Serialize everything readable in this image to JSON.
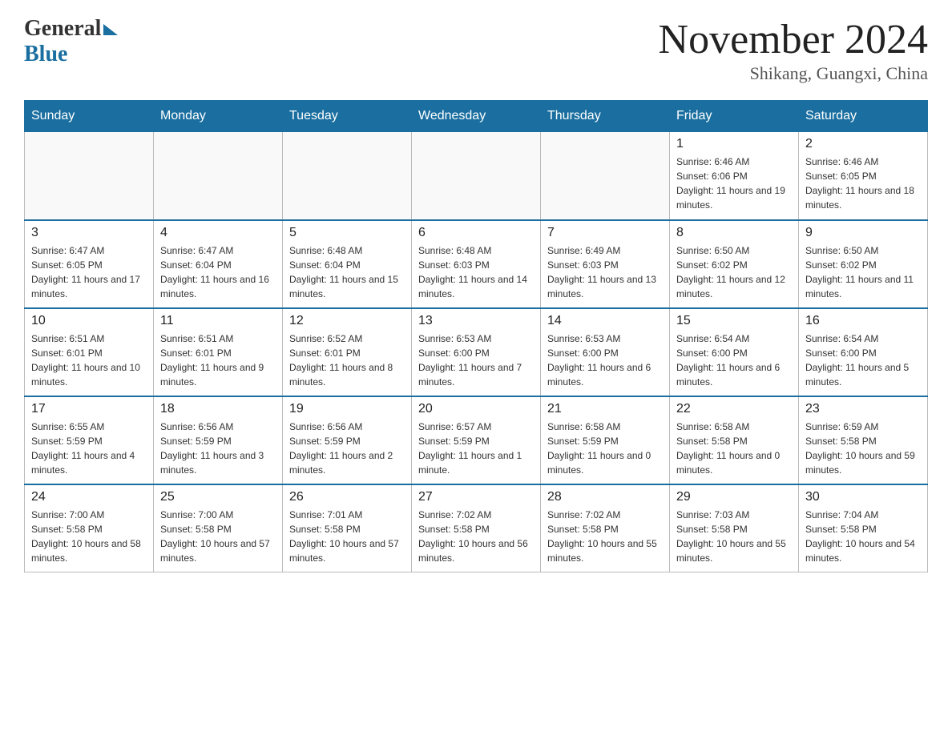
{
  "header": {
    "logo_general": "General",
    "logo_blue": "Blue",
    "month_title": "November 2024",
    "location": "Shikang, Guangxi, China"
  },
  "weekdays": [
    "Sunday",
    "Monday",
    "Tuesday",
    "Wednesday",
    "Thursday",
    "Friday",
    "Saturday"
  ],
  "weeks": [
    [
      {
        "day": "",
        "info": ""
      },
      {
        "day": "",
        "info": ""
      },
      {
        "day": "",
        "info": ""
      },
      {
        "day": "",
        "info": ""
      },
      {
        "day": "",
        "info": ""
      },
      {
        "day": "1",
        "info": "Sunrise: 6:46 AM\nSunset: 6:06 PM\nDaylight: 11 hours and 19 minutes."
      },
      {
        "day": "2",
        "info": "Sunrise: 6:46 AM\nSunset: 6:05 PM\nDaylight: 11 hours and 18 minutes."
      }
    ],
    [
      {
        "day": "3",
        "info": "Sunrise: 6:47 AM\nSunset: 6:05 PM\nDaylight: 11 hours and 17 minutes."
      },
      {
        "day": "4",
        "info": "Sunrise: 6:47 AM\nSunset: 6:04 PM\nDaylight: 11 hours and 16 minutes."
      },
      {
        "day": "5",
        "info": "Sunrise: 6:48 AM\nSunset: 6:04 PM\nDaylight: 11 hours and 15 minutes."
      },
      {
        "day": "6",
        "info": "Sunrise: 6:48 AM\nSunset: 6:03 PM\nDaylight: 11 hours and 14 minutes."
      },
      {
        "day": "7",
        "info": "Sunrise: 6:49 AM\nSunset: 6:03 PM\nDaylight: 11 hours and 13 minutes."
      },
      {
        "day": "8",
        "info": "Sunrise: 6:50 AM\nSunset: 6:02 PM\nDaylight: 11 hours and 12 minutes."
      },
      {
        "day": "9",
        "info": "Sunrise: 6:50 AM\nSunset: 6:02 PM\nDaylight: 11 hours and 11 minutes."
      }
    ],
    [
      {
        "day": "10",
        "info": "Sunrise: 6:51 AM\nSunset: 6:01 PM\nDaylight: 11 hours and 10 minutes."
      },
      {
        "day": "11",
        "info": "Sunrise: 6:51 AM\nSunset: 6:01 PM\nDaylight: 11 hours and 9 minutes."
      },
      {
        "day": "12",
        "info": "Sunrise: 6:52 AM\nSunset: 6:01 PM\nDaylight: 11 hours and 8 minutes."
      },
      {
        "day": "13",
        "info": "Sunrise: 6:53 AM\nSunset: 6:00 PM\nDaylight: 11 hours and 7 minutes."
      },
      {
        "day": "14",
        "info": "Sunrise: 6:53 AM\nSunset: 6:00 PM\nDaylight: 11 hours and 6 minutes."
      },
      {
        "day": "15",
        "info": "Sunrise: 6:54 AM\nSunset: 6:00 PM\nDaylight: 11 hours and 6 minutes."
      },
      {
        "day": "16",
        "info": "Sunrise: 6:54 AM\nSunset: 6:00 PM\nDaylight: 11 hours and 5 minutes."
      }
    ],
    [
      {
        "day": "17",
        "info": "Sunrise: 6:55 AM\nSunset: 5:59 PM\nDaylight: 11 hours and 4 minutes."
      },
      {
        "day": "18",
        "info": "Sunrise: 6:56 AM\nSunset: 5:59 PM\nDaylight: 11 hours and 3 minutes."
      },
      {
        "day": "19",
        "info": "Sunrise: 6:56 AM\nSunset: 5:59 PM\nDaylight: 11 hours and 2 minutes."
      },
      {
        "day": "20",
        "info": "Sunrise: 6:57 AM\nSunset: 5:59 PM\nDaylight: 11 hours and 1 minute."
      },
      {
        "day": "21",
        "info": "Sunrise: 6:58 AM\nSunset: 5:59 PM\nDaylight: 11 hours and 0 minutes."
      },
      {
        "day": "22",
        "info": "Sunrise: 6:58 AM\nSunset: 5:58 PM\nDaylight: 11 hours and 0 minutes."
      },
      {
        "day": "23",
        "info": "Sunrise: 6:59 AM\nSunset: 5:58 PM\nDaylight: 10 hours and 59 minutes."
      }
    ],
    [
      {
        "day": "24",
        "info": "Sunrise: 7:00 AM\nSunset: 5:58 PM\nDaylight: 10 hours and 58 minutes."
      },
      {
        "day": "25",
        "info": "Sunrise: 7:00 AM\nSunset: 5:58 PM\nDaylight: 10 hours and 57 minutes."
      },
      {
        "day": "26",
        "info": "Sunrise: 7:01 AM\nSunset: 5:58 PM\nDaylight: 10 hours and 57 minutes."
      },
      {
        "day": "27",
        "info": "Sunrise: 7:02 AM\nSunset: 5:58 PM\nDaylight: 10 hours and 56 minutes."
      },
      {
        "day": "28",
        "info": "Sunrise: 7:02 AM\nSunset: 5:58 PM\nDaylight: 10 hours and 55 minutes."
      },
      {
        "day": "29",
        "info": "Sunrise: 7:03 AM\nSunset: 5:58 PM\nDaylight: 10 hours and 55 minutes."
      },
      {
        "day": "30",
        "info": "Sunrise: 7:04 AM\nSunset: 5:58 PM\nDaylight: 10 hours and 54 minutes."
      }
    ]
  ]
}
